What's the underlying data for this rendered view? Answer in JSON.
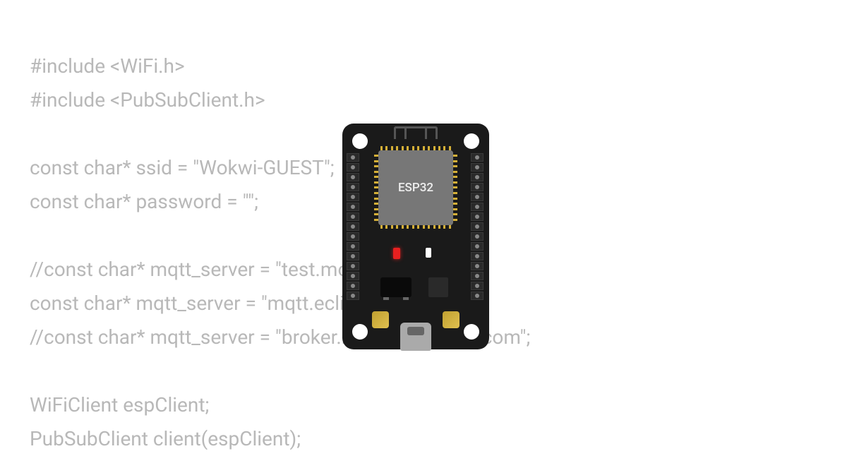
{
  "code": {
    "line1": "#include <WiFi.h>",
    "line2": "#include <PubSubClient.h>",
    "line3": "const char* ssid = \"Wokwi-GUEST\";",
    "line4": "const char* password = \"\";",
    "line5": "//const char* mqtt_server = \"test.mosquitto.org\";",
    "line6": "const char* mqtt_server = \"mqtt.eclipseprojects.io\";",
    "line7": "//const char* mqtt_server = \"broker.mqttdashboard.com\";",
    "line8": "WiFiClient espClient;",
    "line9": "PubSubClient client(espClient);"
  },
  "board": {
    "chip_label": "ESP32"
  }
}
